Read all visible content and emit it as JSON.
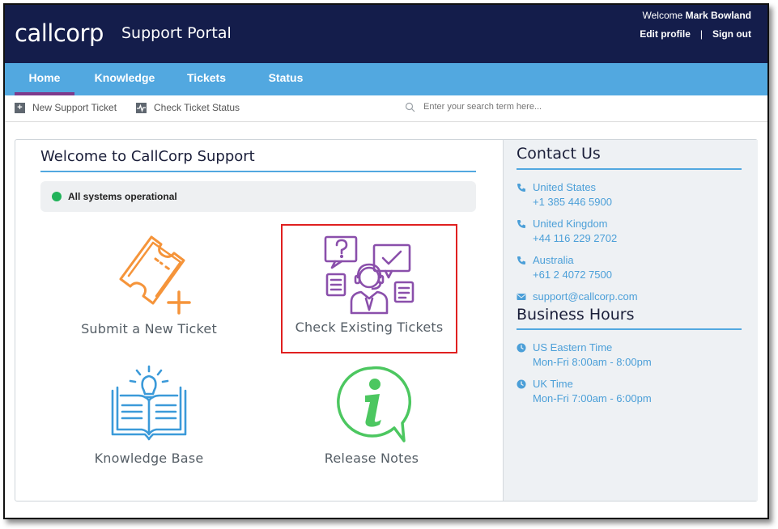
{
  "header": {
    "logo_text": "callcorp",
    "portal_title": "Support Portal",
    "welcome_prefix": "Welcome",
    "user_name": "Mark Bowland",
    "edit_profile": "Edit profile",
    "separator": "|",
    "sign_out": "Sign out"
  },
  "nav": {
    "tabs": [
      {
        "label": "Home",
        "active": true
      },
      {
        "label": "Knowledge"
      },
      {
        "label": "Tickets"
      },
      {
        "label": "Status"
      }
    ]
  },
  "toolbar": {
    "new_ticket": "New Support Ticket",
    "check_status": "Check Ticket Status",
    "search_placeholder": "Enter your search term here..."
  },
  "welcome": {
    "title": "Welcome to CallCorp Support",
    "status_text": "All systems operational",
    "status_color": "#21b35a"
  },
  "tiles": [
    {
      "label": "Submit a New Ticket",
      "icon": "ticket-icon",
      "color": "#f5943a"
    },
    {
      "label": "Check Existing Tickets",
      "icon": "support-agent-icon",
      "color": "#8a4fab",
      "selected": true
    },
    {
      "label": "Knowledge Base",
      "icon": "book-idea-icon",
      "color": "#3b9ad9"
    },
    {
      "label": "Release Notes",
      "icon": "info-bubble-icon",
      "color": "#4cc760"
    }
  ],
  "contact": {
    "title": "Contact Us",
    "entries": [
      {
        "name": "United States",
        "phone": "+1 385 446 5900"
      },
      {
        "name": "United Kingdom",
        "phone": "+44 116 229 2702"
      },
      {
        "name": "Australia",
        "phone": "+61 2 4072 7500"
      }
    ],
    "email": "support@callcorp.com"
  },
  "hours": {
    "title": "Business Hours",
    "entries": [
      {
        "zone": "US Eastern Time",
        "time": "Mon-Fri 8:00am - 8:00pm"
      },
      {
        "zone": "UK Time",
        "time": "Mon-Fri 7:00am - 6:00pm"
      }
    ]
  },
  "colors": {
    "header_bg": "#141d4b",
    "nav_bg": "#52a8e0",
    "active_tab_underline": "#7d3a8c",
    "link_blue": "#4b9fd8",
    "selection_border": "#e02020"
  }
}
